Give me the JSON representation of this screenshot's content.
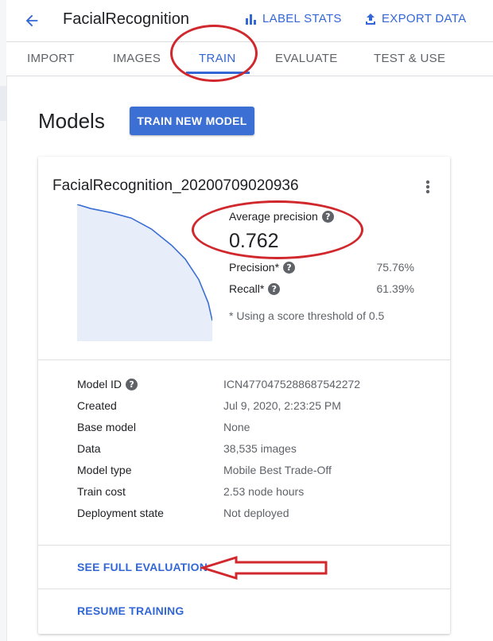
{
  "header": {
    "title": "FacialRecognition",
    "label_stats": "LABEL STATS",
    "export_data": "EXPORT DATA"
  },
  "tabs": [
    {
      "label": "IMPORT",
      "active": false
    },
    {
      "label": "IMAGES",
      "active": false
    },
    {
      "label": "TRAIN",
      "active": true
    },
    {
      "label": "EVALUATE",
      "active": false
    },
    {
      "label": "TEST & USE",
      "active": false
    }
  ],
  "models": {
    "title": "Models",
    "train_button": "TRAIN NEW MODEL"
  },
  "model_card": {
    "name": "FacialRecognition_20200709020936",
    "average_precision_label": "Average precision",
    "average_precision_value": "0.762",
    "metrics": [
      {
        "label": "Precision*",
        "value": "75.76%"
      },
      {
        "label": "Recall*",
        "value": "61.39%"
      }
    ],
    "threshold_note": "* Using a score threshold of 0.5",
    "details": [
      {
        "label": "Model ID",
        "value": "ICN4770475288687542272",
        "help": true
      },
      {
        "label": "Created",
        "value": "Jul 9, 2020, 2:23:25 PM",
        "help": false
      },
      {
        "label": "Base model",
        "value": "None",
        "help": false
      },
      {
        "label": "Data",
        "value": "38,535 images",
        "help": false
      },
      {
        "label": "Model type",
        "value": "Mobile Best Trade-Off",
        "help": false
      },
      {
        "label": "Train cost",
        "value": "2.53 node hours",
        "help": false
      },
      {
        "label": "Deployment state",
        "value": "Not deployed",
        "help": false
      }
    ],
    "see_full_evaluation": "SEE FULL EVALUATION",
    "resume_training": "RESUME TRAINING"
  },
  "colors": {
    "accent": "#3367d6",
    "button": "#3b6fd4",
    "annotation": "#d0282d",
    "curve_fill": "#e8eef9"
  },
  "icons": [
    "arrow-back-icon",
    "bar-chart-icon",
    "upload-icon",
    "more-vert-icon",
    "help-icon"
  ],
  "pr_curve": {
    "recall": [
      0,
      0.1,
      0.25,
      0.4,
      0.55,
      0.7,
      0.8,
      0.9,
      0.97,
      1.0
    ],
    "precision": [
      1.0,
      0.97,
      0.94,
      0.9,
      0.82,
      0.7,
      0.6,
      0.45,
      0.28,
      0.15
    ]
  }
}
